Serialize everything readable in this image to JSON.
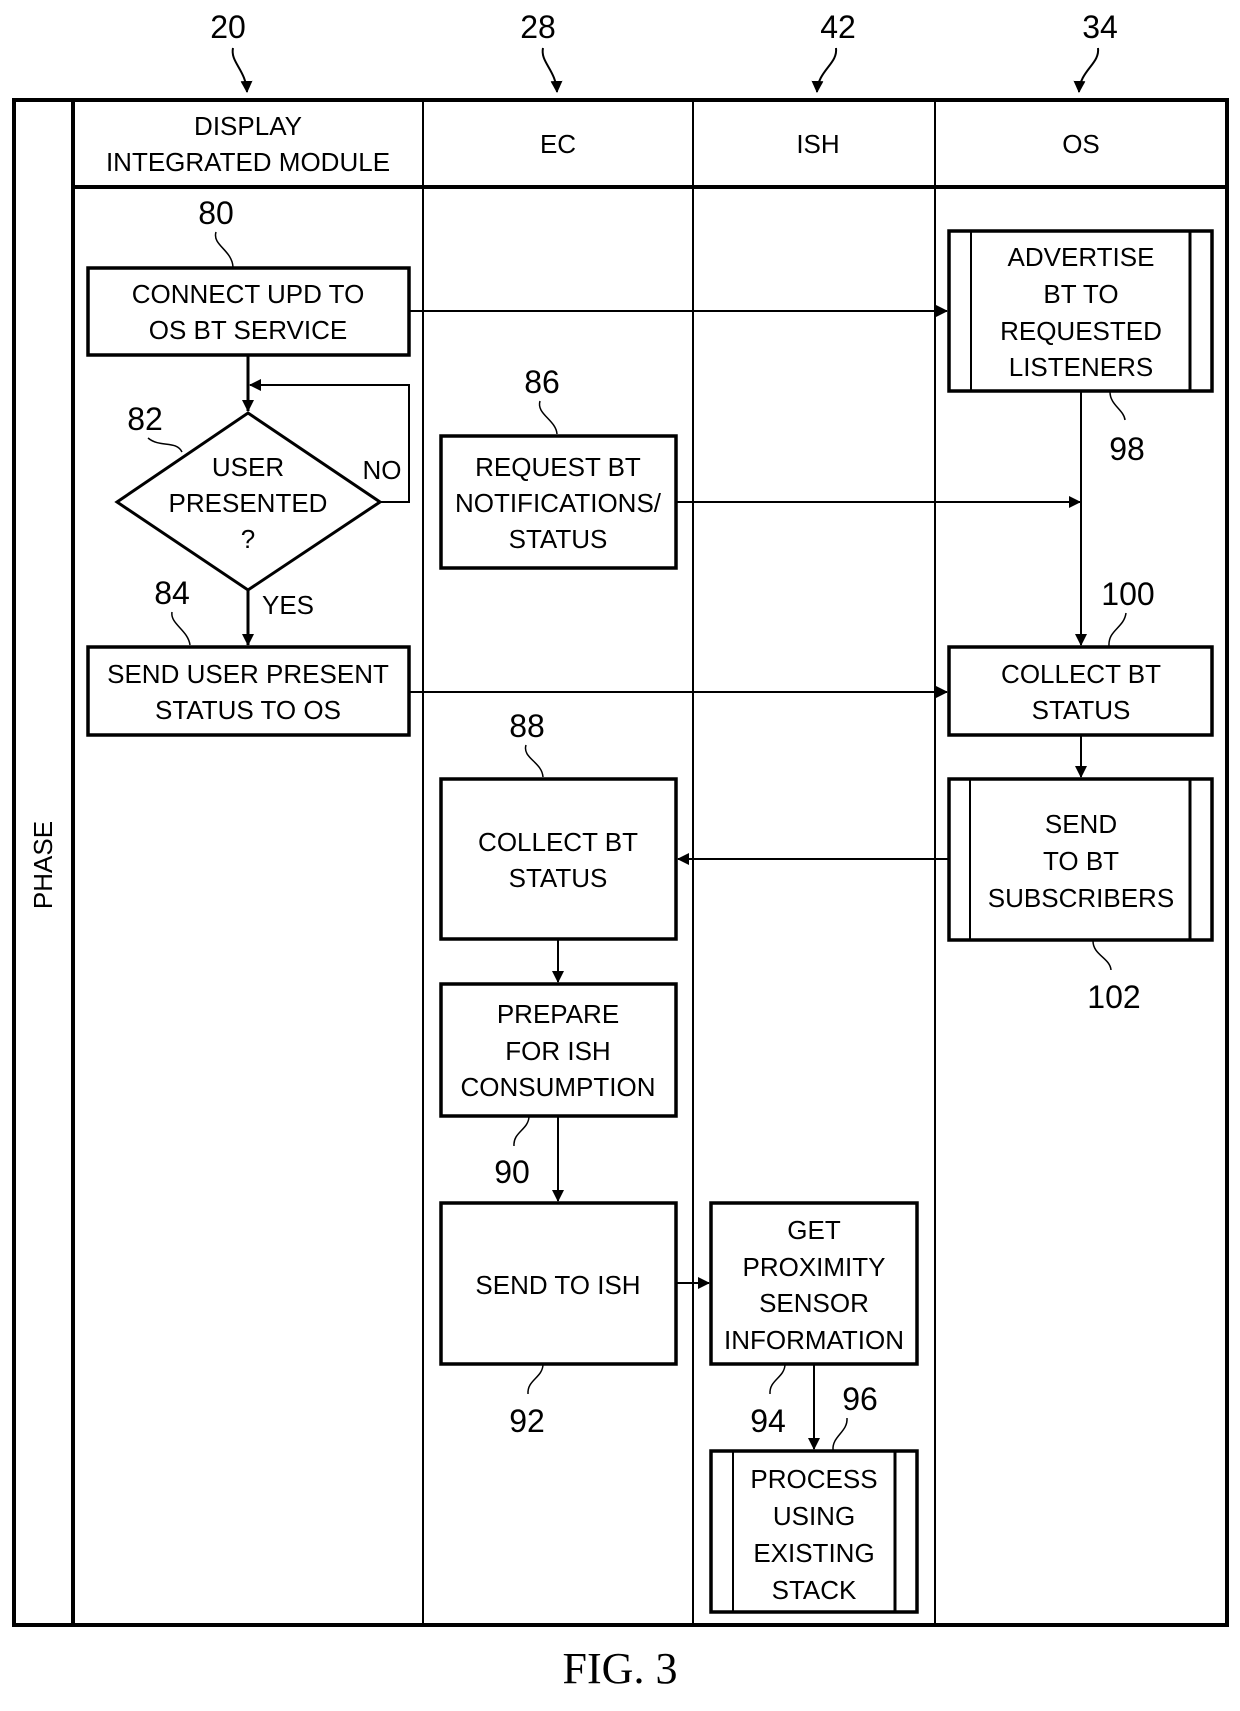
{
  "figure_label": "FIG. 3",
  "phase_label": "PHASE",
  "lanes": [
    {
      "ref": "20",
      "title_lines": [
        "DISPLAY",
        "INTEGRATED MODULE"
      ]
    },
    {
      "ref": "28",
      "title_lines": [
        "EC"
      ]
    },
    {
      "ref": "42",
      "title_lines": [
        "ISH"
      ]
    },
    {
      "ref": "34",
      "title_lines": [
        "OS"
      ]
    }
  ],
  "nodes": {
    "n80": {
      "ref": "80",
      "lines": [
        "CONNECT UPD TO",
        "OS BT SERVICE"
      ]
    },
    "n82": {
      "ref": "82",
      "lines": [
        "USER",
        "PRESENTED",
        "?"
      ],
      "yes": "YES",
      "no": "NO"
    },
    "n84": {
      "ref": "84",
      "lines": [
        "SEND USER PRESENT",
        "STATUS TO OS"
      ]
    },
    "n86": {
      "ref": "86",
      "lines": [
        "REQUEST BT",
        "NOTIFICATIONS/",
        "STATUS"
      ]
    },
    "n88": {
      "ref": "88",
      "lines": [
        "COLLECT BT",
        "STATUS"
      ]
    },
    "n90": {
      "ref": "90",
      "lines": [
        "PREPARE",
        "FOR ISH",
        "CONSUMPTION"
      ]
    },
    "n92": {
      "ref": "92",
      "lines": [
        "SEND TO ISH"
      ]
    },
    "n94": {
      "ref": "94",
      "lines": [
        "GET",
        "PROXIMITY",
        "SENSOR",
        "INFORMATION"
      ]
    },
    "n96": {
      "ref": "96",
      "lines": [
        "PROCESS",
        "USING",
        "EXISTING",
        "STACK"
      ]
    },
    "n98": {
      "ref": "98",
      "lines": [
        "ADVERTISE",
        "BT TO",
        "REQUESTED",
        "LISTENERS"
      ]
    },
    "n100": {
      "ref": "100",
      "lines": [
        "COLLECT BT",
        "STATUS"
      ]
    },
    "n102": {
      "ref": "102",
      "lines": [
        "SEND",
        "TO BT",
        "SUBSCRIBERS"
      ]
    }
  }
}
